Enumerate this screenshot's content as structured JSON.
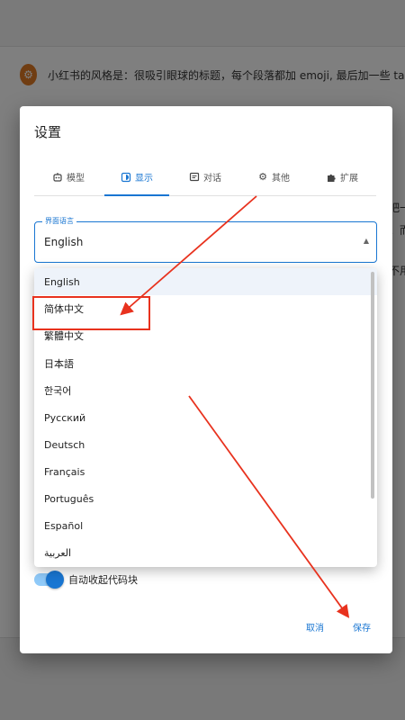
{
  "background": {
    "message": "小红书的风格是：很吸引眼球的标题，每个段落都加 emoji, 最后加一些 tag。请用小红书风格",
    "side_fragments": [
      "吧一",
      "。而",
      "不用"
    ]
  },
  "dialog": {
    "title": "设置",
    "tabs": [
      {
        "label": "模型",
        "icon": "robot-icon"
      },
      {
        "label": "显示",
        "icon": "display-icon"
      },
      {
        "label": "对话",
        "icon": "chat-icon"
      },
      {
        "label": "其他",
        "icon": "gear-icon"
      },
      {
        "label": "扩展",
        "icon": "puzzle-icon"
      }
    ],
    "active_tab": "显示",
    "language_field": {
      "label": "界面语言",
      "value": "English"
    },
    "options": [
      "English",
      "简体中文",
      "繁體中文",
      "日本語",
      "한국어",
      "Русский",
      "Deutsch",
      "Français",
      "Português",
      "Español",
      "العربية"
    ],
    "toggle": {
      "label": "自动收起代码块",
      "checked": true
    },
    "buttons": {
      "cancel": "取消",
      "save": "保存"
    }
  },
  "colors": {
    "accent": "#1976d2",
    "annotation_red": "#e8321e"
  }
}
